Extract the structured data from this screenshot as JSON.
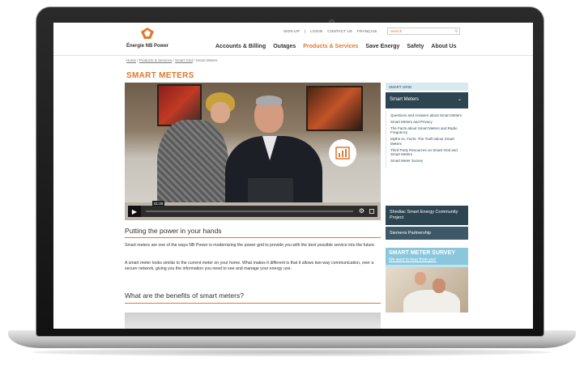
{
  "site": {
    "logo_text": "Énergie NB Power",
    "brand_color": "#e0782e",
    "util_nav": [
      "SIGN UP",
      "LOGIN",
      "CONTACT US",
      "FRANÇAIS"
    ],
    "search_placeholder": "Search",
    "main_nav": [
      {
        "label": "Accounts & Billing",
        "active": false
      },
      {
        "label": "Outages",
        "active": false
      },
      {
        "label": "Products & Services",
        "active": true
      },
      {
        "label": "Save Energy",
        "active": false
      },
      {
        "label": "Safety",
        "active": false
      },
      {
        "label": "About Us",
        "active": false
      }
    ]
  },
  "breadcrumb": {
    "items": [
      "Home",
      "Products & Services",
      "Smart Grid",
      "Smart Meters"
    ]
  },
  "page": {
    "title": "SMART METERS",
    "video": {
      "time": "01:29",
      "icons": [
        "play-icon",
        "gear-icon",
        "fullscreen-icon",
        "chart-icon"
      ]
    },
    "h2_power": "Putting the power in your hands",
    "para1": "Smart meters are one of the ways NB Power is modernizing the power grid to provide you with the best possible service into the future.",
    "para2": "A smart meter looks similar to the current meter on your home. What makes it different is that it allows two-way communication, over a secure network, giving you the information you need to see and manage your energy use.",
    "h2_benefits": "What are the benefits of smart meters?"
  },
  "sidebar": {
    "section_label": "SMART GRID",
    "active_item": "Smart Meters",
    "sub_items": [
      "Questions and Answers about Smart Meters",
      "Smart Meters and Privacy",
      "The Facts about Smart Meters and Radio Frequency",
      "Myths vs. Facts: The Truth about Smart Meters",
      "Third Party Resources on Smart Grid and Smart Meters",
      "Smart Meter Survey"
    ],
    "shediac": "Shediac Smart Energy Community Project",
    "siemens": "Siemens Partnership",
    "survey_title": "SMART METER SURVEY",
    "survey_link": "We want to hear from you!"
  }
}
